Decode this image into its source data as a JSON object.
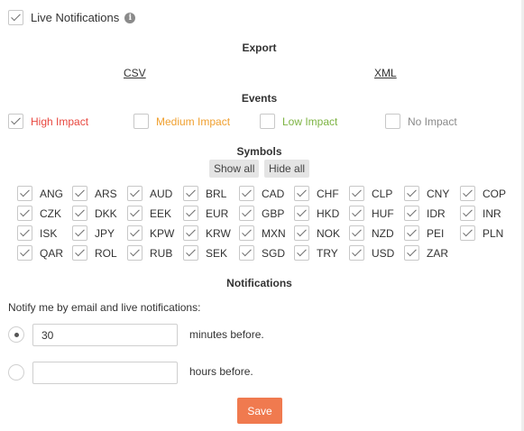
{
  "live_notifications": {
    "label": "Live Notifications",
    "checked": true,
    "info_icon": "info-icon"
  },
  "export": {
    "title": "Export",
    "links": [
      "CSV",
      "XML"
    ]
  },
  "events": {
    "title": "Events",
    "items": [
      {
        "label": "High Impact",
        "checked": true,
        "color": "#e8473f"
      },
      {
        "label": "Medium Impact",
        "checked": false,
        "color": "#f0a030"
      },
      {
        "label": "Low Impact",
        "checked": false,
        "color": "#7cb342"
      },
      {
        "label": "No Impact",
        "checked": false,
        "color": "#8a8a8a"
      }
    ]
  },
  "symbols": {
    "title": "Symbols",
    "show_all": "Show all",
    "hide_all": "Hide all",
    "items": [
      "ANG",
      "ARS",
      "AUD",
      "BRL",
      "CAD",
      "CHF",
      "CLP",
      "CNY",
      "COP",
      "CZK",
      "DKK",
      "EEK",
      "EUR",
      "GBP",
      "HKD",
      "HUF",
      "IDR",
      "INR",
      "ISK",
      "JPY",
      "KPW",
      "KRW",
      "MXN",
      "NOK",
      "NZD",
      "PEI",
      "PLN",
      "QAR",
      "ROL",
      "RUB",
      "SEK",
      "SGD",
      "TRY",
      "USD",
      "ZAR"
    ]
  },
  "notifications": {
    "title": "Notifications",
    "prompt": "Notify me by email and live notifications:",
    "minutes": {
      "value": "30",
      "suffix": "minutes before.",
      "selected": true
    },
    "hours": {
      "value": "",
      "suffix": "hours before.",
      "selected": false
    },
    "save_label": "Save"
  }
}
